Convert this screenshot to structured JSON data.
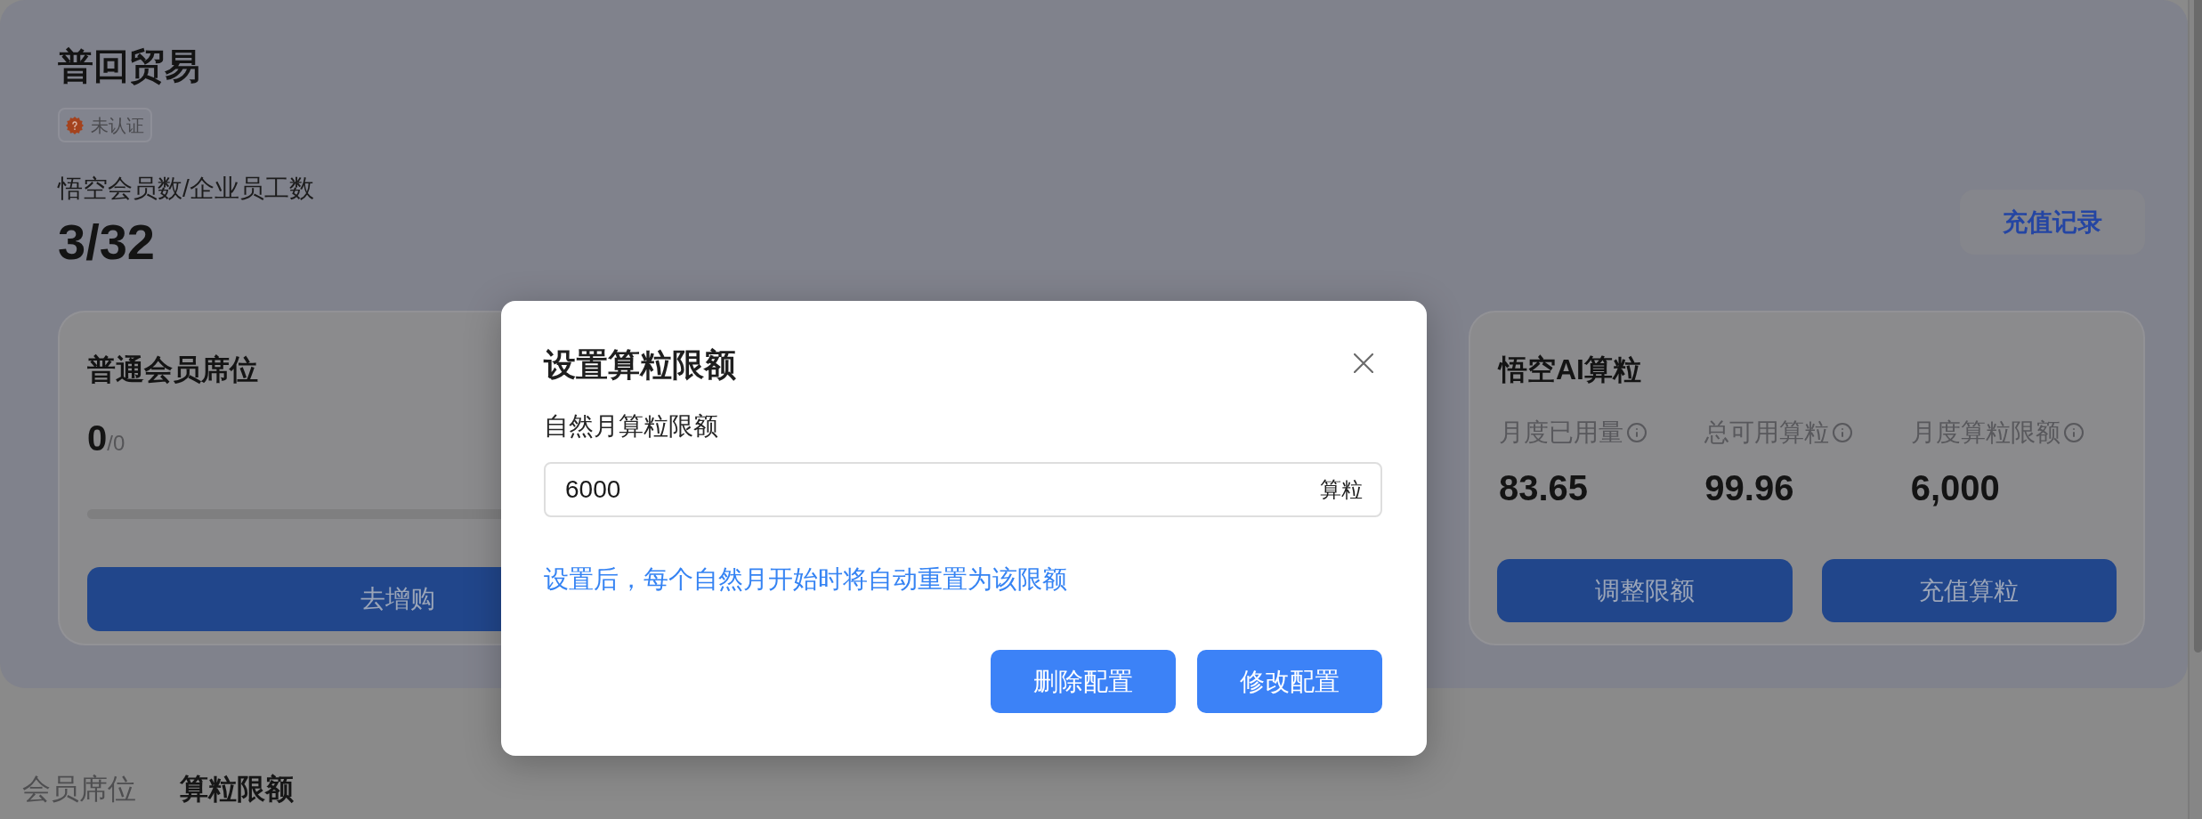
{
  "company": {
    "name": "普回贸易",
    "badge": "未认证"
  },
  "member_summary": {
    "label": "悟空会员数/企业员工数",
    "value": "3/32"
  },
  "recharge_record_button": "充值记录",
  "seat_card": {
    "title": "普通会员席位",
    "count": "0",
    "of_total": "/0",
    "level": 0,
    "button": "去增购"
  },
  "compute_card": {
    "title": "悟空AI算粒",
    "stats": [
      {
        "label": "月度已用量",
        "value": "83.65"
      },
      {
        "label": "总可用算粒",
        "value": "99.96"
      },
      {
        "label": "月度算粒限额",
        "value": "6,000"
      }
    ],
    "buttons": [
      "调整限额",
      "充值算粒"
    ]
  },
  "tabs": [
    {
      "label": "会员席位",
      "selected": false
    },
    {
      "label": "算粒限额",
      "selected": true
    }
  ],
  "dialog": {
    "title": "设置算粒限额",
    "field_label": "自然月算粒限额",
    "value": "6000",
    "unit": "算粒",
    "hint": "设置后，每个自然月开始时将自动重置为该限额",
    "buttons": [
      "删除配置",
      "修改配置"
    ]
  }
}
